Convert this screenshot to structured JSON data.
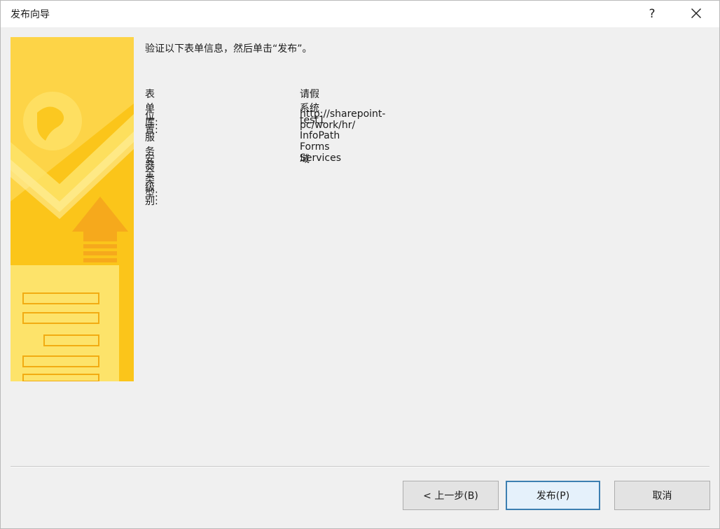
{
  "window": {
    "title": "发布向导",
    "help_label": "?"
  },
  "main": {
    "instruction": "验证以下表单信息，然后单击“发布”。",
    "info_rows": [
      {
        "label": "表单库:",
        "value": "请假系统test1"
      },
      {
        "label": "位置:",
        "value": "http://sharepoint-pc/work/hr/"
      },
      {
        "label": "服务器类型:",
        "value": "InfoPath Forms Services"
      },
      {
        "label": "安全级别:",
        "value": "域"
      }
    ]
  },
  "buttons": {
    "back_label": "< 上一步(B)",
    "publish_label": "发布(P)",
    "cancel_label": "取消"
  },
  "icons": {
    "close": "close-icon",
    "banner": "wizard-banner-illustration"
  },
  "colors": {
    "banner_primary": "#fbc51a",
    "banner_light": "#fde36a",
    "default_button_border": "#3c7fb1"
  }
}
